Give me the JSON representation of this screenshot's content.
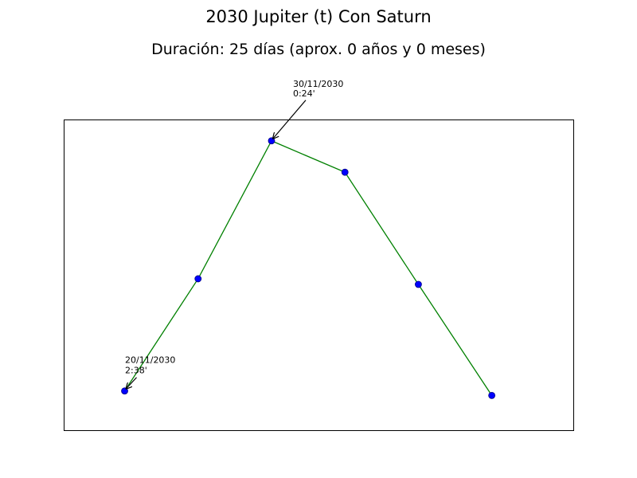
{
  "chart_data": {
    "type": "line",
    "title": "2030 Jupiter (t) Con Saturn",
    "subtitle": "Duración: 25 días (aprox. 0 años y 0 meses)",
    "xlabel": "",
    "ylabel": "",
    "grid": false,
    "axis_ticks": false,
    "line_color": "#008000",
    "marker_color": "#0000ff",
    "marker_edge_color": "#000080",
    "series": [
      {
        "x": [
          0,
          1,
          2,
          3,
          4,
          5
        ],
        "y": [
          2.63,
          1.63,
          0.4,
          0.68,
          1.68,
          2.67
        ]
      }
    ],
    "ylim": [
      2.98,
      0.21
    ],
    "xlim": [
      -0.83,
      6.11
    ],
    "annotations": [
      {
        "point_index": 0,
        "date": "20/11/2030",
        "value": "2:38'"
      },
      {
        "point_index": 2,
        "date": "30/11/2030",
        "value": "0:24'"
      }
    ]
  }
}
